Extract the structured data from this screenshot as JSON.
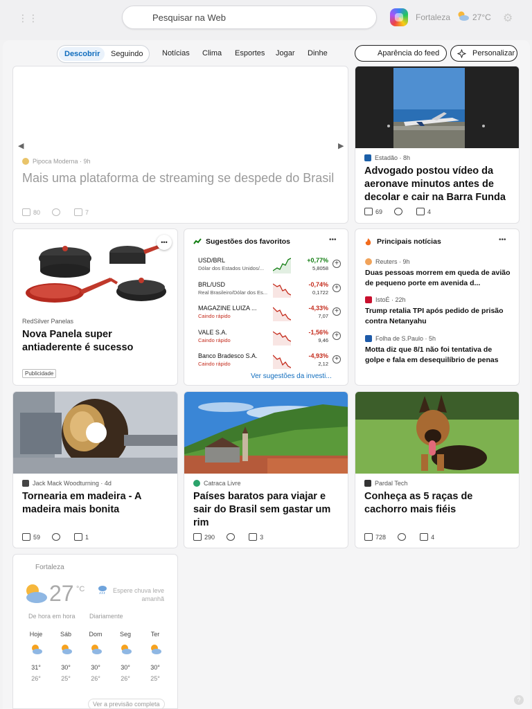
{
  "header": {
    "search_placeholder": "Pesquisar na Web",
    "location": "Fortaleza",
    "temperature": "27°C"
  },
  "tabs": [
    "Descobrir",
    "Seguindo"
  ],
  "nav": [
    "Notícias",
    "Clima",
    "Esportes",
    "Jogar",
    "Dinhe"
  ],
  "buttons": {
    "feed": "Aparência do feed",
    "personalize": "Personalizar"
  },
  "hero": {
    "source": "Pipoca Moderna · 9h",
    "title": "Mais uma plataforma de streaming se despede do Brasil",
    "likes": "80",
    "comments": "7"
  },
  "card_estadao": {
    "source": "Estadão · 8h",
    "title": "Advogado postou vídeo da aeronave minutos antes de decolar e cair na Barra Funda",
    "likes": "69",
    "comments": "4"
  },
  "card_panela": {
    "source": "RedSilver Panelas",
    "title": "Nova Panela super antiaderente é sucesso",
    "badge": "Publicidade",
    "more": "•••"
  },
  "stocks": {
    "title": "Sugestões dos favoritos",
    "link": "Ver sugestões da investi...",
    "items": [
      {
        "name": "USD/BRL",
        "desc": "Dólar dos Estados Unidos/...",
        "pct": "+0,77%",
        "val": "5,8058",
        "up": true
      },
      {
        "name": "BRL/USD",
        "desc": "Real Brasileiro/Dólar dos Es...",
        "pct": "-0,74%",
        "val": "0,1722",
        "up": false
      },
      {
        "name": "MAGAZINE LUIZA ...",
        "desc": "Caindo rápido",
        "pct": "-4,33%",
        "val": "7,07",
        "up": false
      },
      {
        "name": "VALE S.A.",
        "desc": "Caindo rápido",
        "pct": "-1,56%",
        "val": "9,46",
        "up": false
      },
      {
        "name": "Banco Bradesco S.A.",
        "desc": "Caindo rápido",
        "pct": "-4,93%",
        "val": "2,12",
        "up": false
      }
    ]
  },
  "top_news": {
    "title": "Principais notícias",
    "items": [
      {
        "source": "Reuters · 9h",
        "headline": "Duas pessoas morrem em queda de avião de pequeno porte em avenida d..."
      },
      {
        "source": "IstoÉ · 22h",
        "headline": "Trump retalia TPI após pedido de prisão contra Netanyahu"
      },
      {
        "source": "Folha de S.Paulo · 5h",
        "headline": "Motta diz que 8/1 não foi tentativa de golpe e fala em desequilíbrio de penas"
      }
    ]
  },
  "card_madeira": {
    "source": "Jack Mack Woodturning · 4d",
    "title": "Tornearia em madeira - A madeira mais bonita",
    "likes": "59",
    "comments": "1"
  },
  "card_paises": {
    "source": "Catraca Livre",
    "title": "Países baratos para viajar e sair do Brasil sem gastar um rim",
    "likes": "290",
    "comments": "3"
  },
  "card_caes": {
    "source": "Pardal Tech",
    "title": "Conheça as 5 raças de cachorro mais fiéis",
    "likes": "728",
    "comments": "4"
  },
  "weather": {
    "city": "Fortaleza",
    "temp": "27",
    "unit": "°C",
    "note": "Espere chuva leve amanhã",
    "tab_hourly": "De hora em hora",
    "tab_daily": "Diariamente",
    "days": [
      {
        "d": "Hoje",
        "hi": "31°",
        "lo": "26°"
      },
      {
        "d": "Sáb",
        "hi": "30°",
        "lo": "25°"
      },
      {
        "d": "Dom",
        "hi": "30°",
        "lo": "26°"
      },
      {
        "d": "Seg",
        "hi": "30°",
        "lo": "26°"
      },
      {
        "d": "Ter",
        "hi": "30°",
        "lo": "25°"
      }
    ],
    "link": "Ver a previsão completa"
  }
}
